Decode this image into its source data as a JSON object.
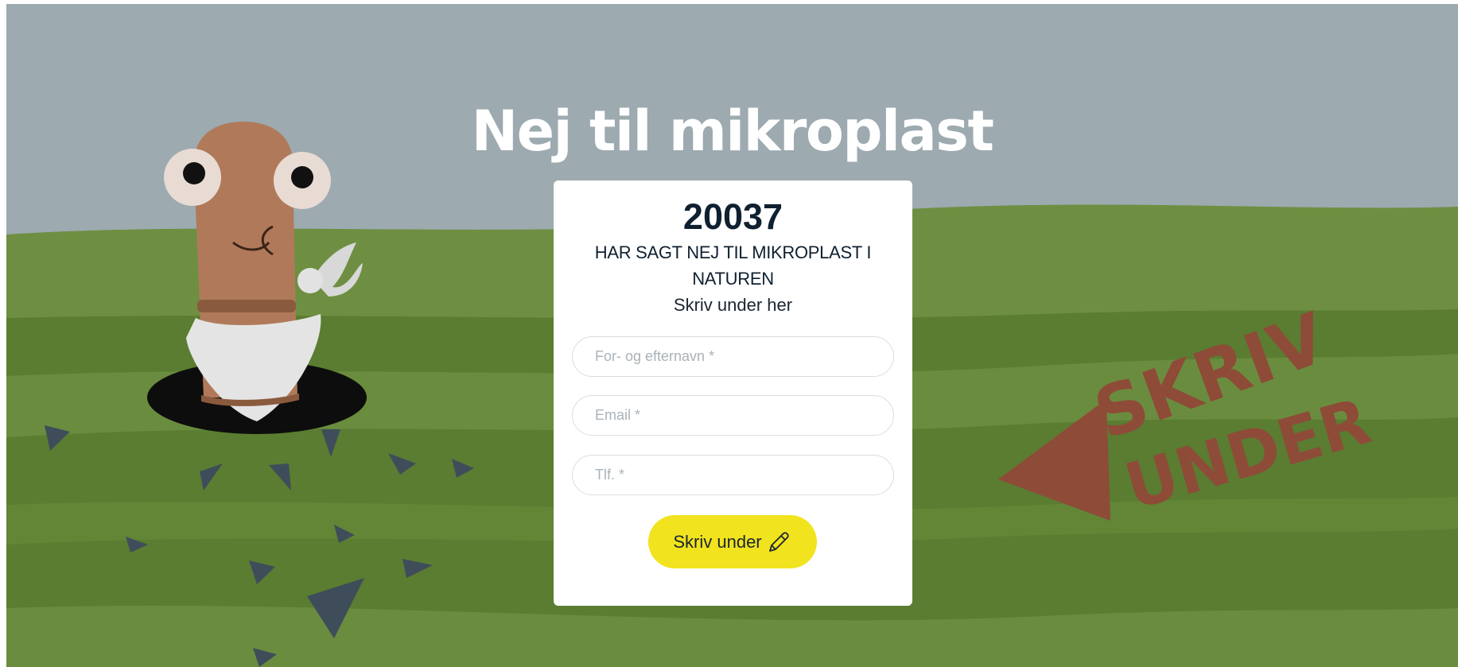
{
  "page": {
    "headline": "Nej til mikroplast"
  },
  "petition": {
    "count": "20037",
    "subtitle": "HAR SAGT NEJ TIL MIKROPLAST I NATUREN",
    "cta": "Skriv under her"
  },
  "form": {
    "name_placeholder": "For- og efternavn *",
    "email_placeholder": "Email *",
    "phone_placeholder": "Tlf. *",
    "submit_label": "Skriv under",
    "submit_icon": "pencil-icon"
  },
  "background": {
    "sign_line1": "SKRIV",
    "sign_line2": "UNDER",
    "colors": {
      "sky": "#9daab0",
      "grass_light": "#6e8f42",
      "grass_dark": "#567a2e",
      "worm": "#b07a5a",
      "sign": "#8e4b38",
      "button": "#f1e31e",
      "text_dark": "#0f2030"
    }
  }
}
